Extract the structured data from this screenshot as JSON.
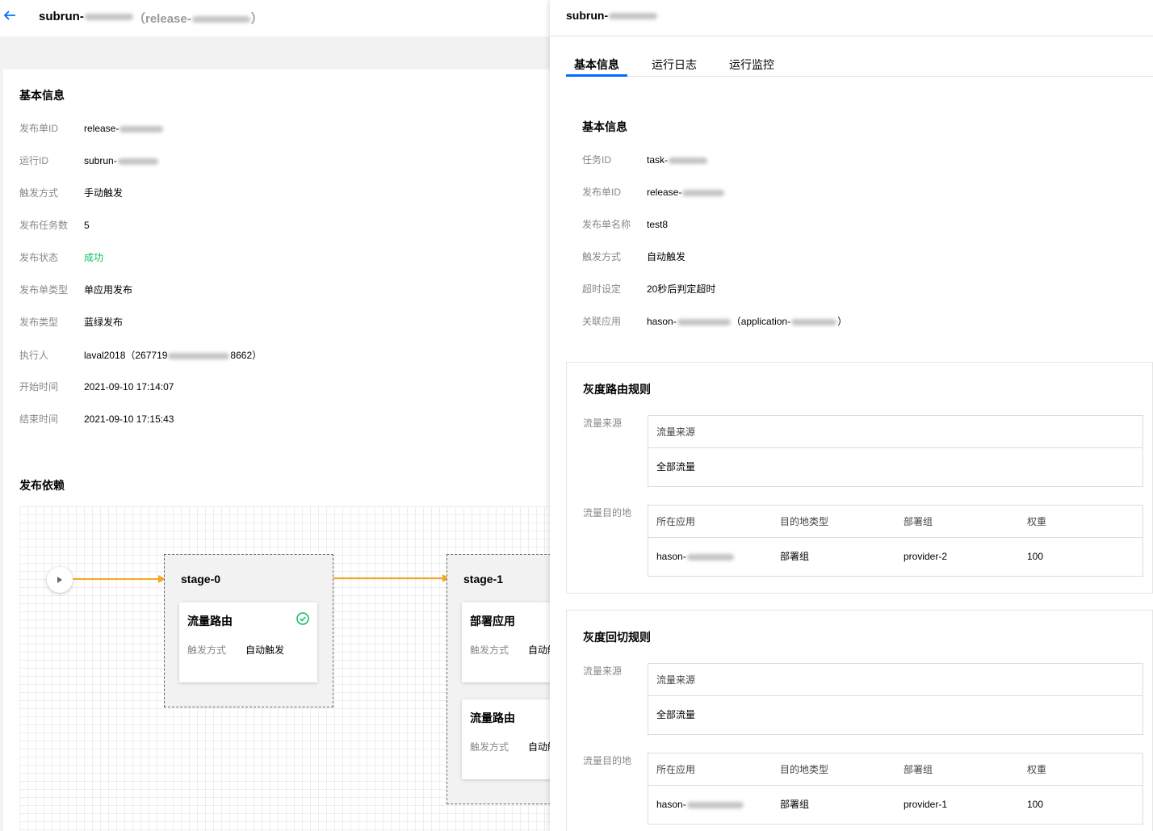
{
  "left": {
    "title": "subrun-",
    "subtitle_open": "（release-",
    "subtitle_close": "）",
    "basic_info_title": "基本信息",
    "rows": [
      {
        "label": "发布单ID",
        "value": "release-"
      },
      {
        "label": "运行ID",
        "value": "subrun-"
      },
      {
        "label": "触发方式",
        "value": "手动触发"
      },
      {
        "label": "发布任务数",
        "value": "5"
      },
      {
        "label": "发布状态",
        "value": "成功"
      },
      {
        "label": "发布单类型",
        "value": "单应用发布"
      },
      {
        "label": "发布类型",
        "value": "蓝绿发布"
      },
      {
        "label": "执行人",
        "value": "laval2018（267719",
        "value_tail": "8662）"
      },
      {
        "label": "开始时间",
        "value": "2021-09-10 17:14:07"
      },
      {
        "label": "结束时间",
        "value": "2021-09-10 17:15:43"
      }
    ],
    "deps_title": "发布依赖",
    "stages": [
      {
        "title": "stage-0",
        "tasks": [
          {
            "name": "流量路由",
            "trigger_label": "触发方式",
            "trigger_value": "自动触发",
            "status_icon": "check-circle-icon"
          }
        ]
      },
      {
        "title": "stage-1",
        "tasks": [
          {
            "name": "部署应用",
            "trigger_label": "触发方式",
            "trigger_value": "自动触发"
          },
          {
            "name": "流量路由",
            "trigger_label": "触发方式",
            "trigger_value": "自动触发"
          }
        ]
      }
    ],
    "colors": {
      "success": "#0abf5b",
      "flow_line": "#f5a623",
      "link": "#006eff"
    }
  },
  "drawer": {
    "title": "subrun-",
    "tabs": [
      {
        "label": "基本信息",
        "active": true
      },
      {
        "label": "运行日志",
        "active": false
      },
      {
        "label": "运行监控",
        "active": false
      }
    ],
    "basic_info_title": "基本信息",
    "rows": [
      {
        "label": "任务ID",
        "value": "task-"
      },
      {
        "label": "发布单ID",
        "value": "release-"
      },
      {
        "label": "发布单名称",
        "value": "test8"
      },
      {
        "label": "触发方式",
        "value": "自动触发"
      },
      {
        "label": "超时设定",
        "value": "20秒后判定超时"
      },
      {
        "label": "关联应用",
        "value": "hason-",
        "value_mid": "（application-",
        "value_tail": "）"
      }
    ],
    "rules": [
      {
        "title": "灰度路由规则",
        "source_label": "流量来源",
        "source_header": "流量来源",
        "source_value": "全部流量",
        "dest_label": "流量目的地",
        "columns": [
          "所在应用",
          "目的地类型",
          "部署组",
          "权重"
        ],
        "row": [
          "hason-",
          "部署组",
          "provider-2",
          "100"
        ]
      },
      {
        "title": "灰度回切规则",
        "source_label": "流量来源",
        "source_header": "流量来源",
        "source_value": "全部流量",
        "dest_label": "流量目的地",
        "columns": [
          "所在应用",
          "目的地类型",
          "部署组",
          "权重"
        ],
        "row": [
          "hason-",
          "部署组",
          "provider-1",
          "100"
        ]
      }
    ]
  }
}
